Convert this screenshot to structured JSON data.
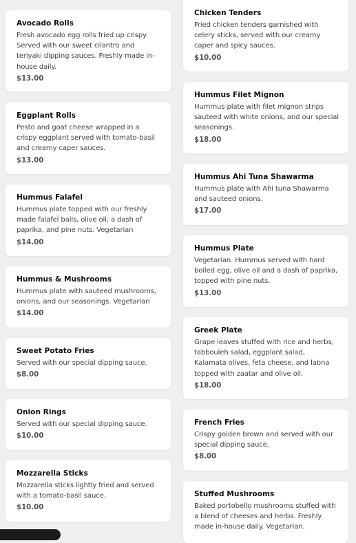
{
  "menu": {
    "left": [
      {
        "title": "Avocado Rolls",
        "desc": "Fresh avocado egg rolls fried up crispy. Served with our sweet cilantro and teriyaki dipping sauces. Freshly made in-house daily.",
        "price": "$13.00"
      },
      {
        "title": "Eggplant Rolls",
        "desc": "Pesto and goat cheese wrapped in a crispy eggplant served with tomato-basil and creamy caper sauces.",
        "price": "$13.00"
      },
      {
        "title": "Hummus Falafel",
        "desc": "Hummus plate topped with our freshly made falafel balls, olive oil, a dash of paprika, and pine nuts. Vegetarian",
        "price": "$14.00"
      },
      {
        "title": "Hummus & Mushrooms",
        "desc": "Hummus plate with sauteed mushrooms, onions, and our seasonings. Vegetarian",
        "price": "$14.00"
      },
      {
        "title": "Sweet Potato Fries",
        "desc": "Served with our special dipping sauce.",
        "price": "$8.00"
      },
      {
        "title": "Onion Rings",
        "desc": "Served with our special dipping sauce.",
        "price": "$10.00"
      },
      {
        "title": "Mozzarella Sticks",
        "desc": "Mozzarella sticks lightly fried and served with a tomato-basil sauce.",
        "price": "$10.00"
      }
    ],
    "right": [
      {
        "title": "Chicken Tenders",
        "desc": "Fried chicken tenders garnished with celery sticks, served with our creamy caper and spicy sauces.",
        "price": "$10.00"
      },
      {
        "title": "Hummus Filet Mignon",
        "desc": "Hummus plate with filet mignon strips sauteed with white onions, and our special seasonings.",
        "price": "$18.00"
      },
      {
        "title": "Hummus Ahi Tuna Shawarma",
        "desc": "Hummus plate with Ahi tuna Shawarma and sauteed onions.",
        "price": "$17.00"
      },
      {
        "title": "Hummus Plate",
        "desc": "Vegetarian. Hummus served with hard boiled egg, olive oil and a dash of paprika, topped with pine nuts.",
        "price": "$13.00"
      },
      {
        "title": "Greek Plate",
        "desc": "Grape leaves stuffed with rice and herbs, tabbouleh salad, eggplant salad, Kalamata olives, feta cheese, and labna topped with zaatar and olive oil.",
        "price": "$18.00"
      },
      {
        "title": "French Fries",
        "desc": "Crispy golden brown and served with our special dipping sauce.",
        "price": "$8.00"
      },
      {
        "title": "Stuffed Mushrooms",
        "desc": "Baked portobello mushrooms stuffed with a blend of cheeses and herbs. Freshly made in-house daily. Vegetarian.",
        "price": ""
      }
    ]
  }
}
